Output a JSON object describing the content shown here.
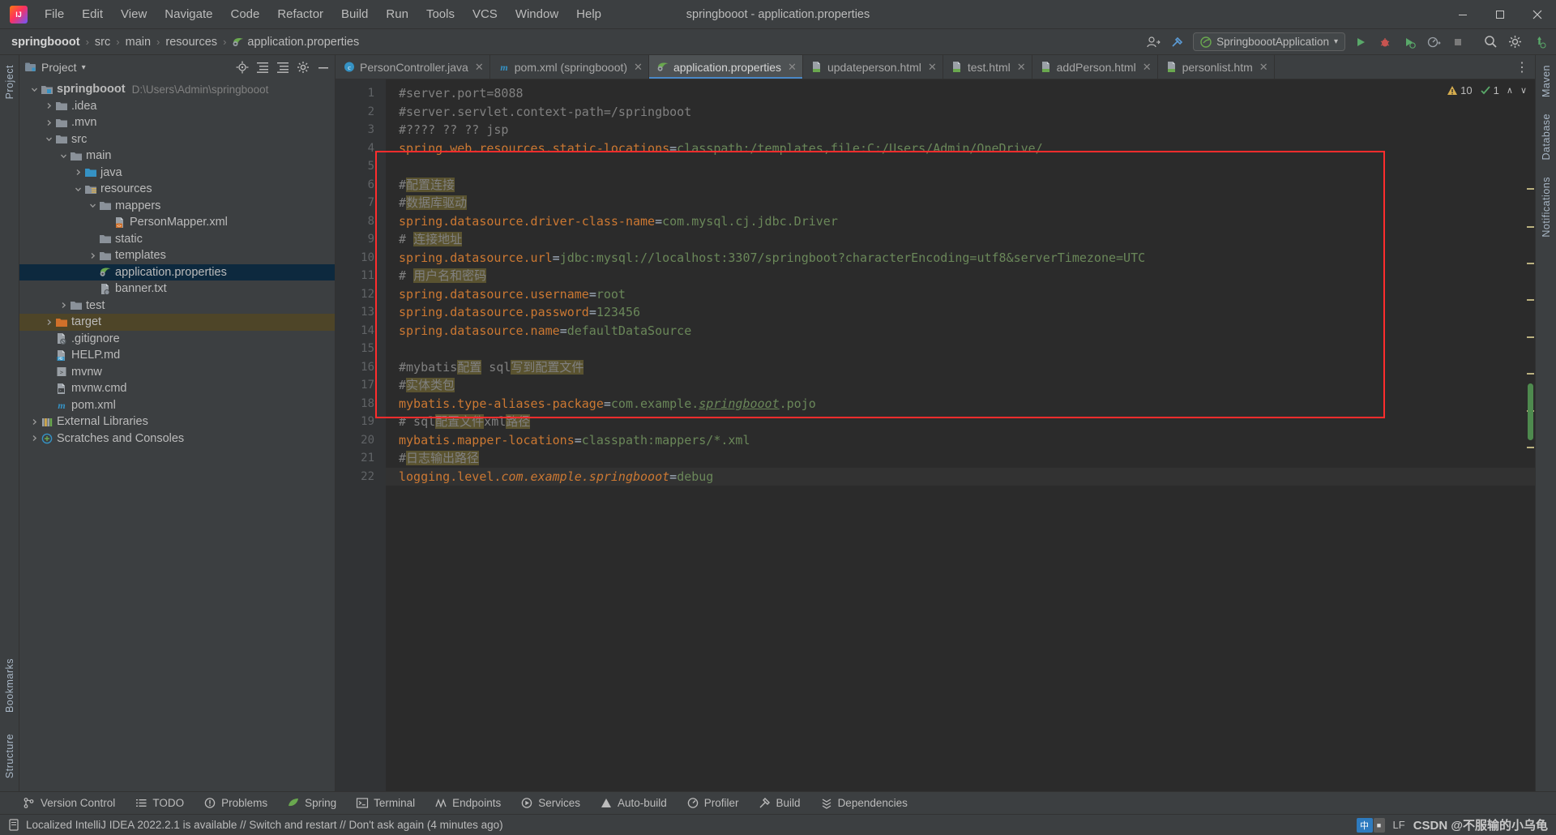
{
  "window": {
    "title": "springbooot - application.properties",
    "logo_icon": "intellij-idea-logo",
    "minimize_label": "—",
    "maximize_label": "❐",
    "close_label": "✕"
  },
  "menu": {
    "items": [
      {
        "label": "File"
      },
      {
        "label": "Edit"
      },
      {
        "label": "View"
      },
      {
        "label": "Navigate"
      },
      {
        "label": "Code"
      },
      {
        "label": "Refactor"
      },
      {
        "label": "Build"
      },
      {
        "label": "Run"
      },
      {
        "label": "Tools"
      },
      {
        "label": "VCS"
      },
      {
        "label": "Window"
      },
      {
        "label": "Help"
      }
    ]
  },
  "breadcrumb": {
    "sep": "›",
    "items": [
      {
        "label": "springbooot",
        "bold": true,
        "icon": ""
      },
      {
        "label": "src",
        "bold": false,
        "icon": ""
      },
      {
        "label": "main",
        "bold": false,
        "icon": ""
      },
      {
        "label": "resources",
        "bold": false,
        "icon": ""
      },
      {
        "label": "application.properties",
        "bold": false,
        "icon": "properties-file-icon"
      }
    ]
  },
  "navbar_right": {
    "profile_icon": "user-avatar-icon",
    "hammer_icon": "build-hammer-icon",
    "run_config": "SpringboootApplication",
    "run_config_chevron": "▾",
    "run_icon": "run-play-icon",
    "debug_icon": "debug-bug-icon",
    "coverage_icon": "run-with-coverage-icon",
    "profile_icon2": "profiler-icon",
    "stop_icon": "stop-icon",
    "search_icon": "search-everywhere-icon",
    "settings_icon": "settings-gear-icon",
    "updates_icon": "updates-icon"
  },
  "left_rail": {
    "top_label": "Project",
    "bottom_labels": [
      "Bookmarks",
      "Structure"
    ]
  },
  "right_rail": {
    "labels": [
      "Maven",
      "Database",
      "Notifications"
    ]
  },
  "project_panel": {
    "title": "Project",
    "title_chevron": "▾",
    "icons": [
      "locate-file-icon",
      "expand-all-icon",
      "collapse-all-icon",
      "settings-gear-icon",
      "hide-icon"
    ],
    "tree": [
      {
        "depth": 0,
        "twisty": "v",
        "icon": "module-folder-icon",
        "label": "springbooot",
        "bold": true,
        "path": "D:\\Users\\Admin\\springbooot",
        "state": "normal"
      },
      {
        "depth": 1,
        "twisty": ">",
        "icon": "folder-icon",
        "label": ".idea",
        "bold": false,
        "path": "",
        "state": "normal"
      },
      {
        "depth": 1,
        "twisty": ">",
        "icon": "folder-icon",
        "label": ".mvn",
        "bold": false,
        "path": "",
        "state": "normal"
      },
      {
        "depth": 1,
        "twisty": "v",
        "icon": "folder-icon",
        "label": "src",
        "bold": false,
        "path": "",
        "state": "normal"
      },
      {
        "depth": 2,
        "twisty": "v",
        "icon": "folder-icon",
        "label": "main",
        "bold": false,
        "path": "",
        "state": "normal"
      },
      {
        "depth": 3,
        "twisty": ">",
        "icon": "source-root-icon",
        "label": "java",
        "bold": false,
        "path": "",
        "state": "normal"
      },
      {
        "depth": 3,
        "twisty": "v",
        "icon": "resources-root-icon",
        "label": "resources",
        "bold": false,
        "path": "",
        "state": "normal"
      },
      {
        "depth": 4,
        "twisty": "v",
        "icon": "folder-icon",
        "label": "mappers",
        "bold": false,
        "path": "",
        "state": "normal"
      },
      {
        "depth": 5,
        "twisty": "",
        "icon": "xml-file-icon",
        "label": "PersonMapper.xml",
        "bold": false,
        "path": "",
        "state": "normal"
      },
      {
        "depth": 4,
        "twisty": "",
        "icon": "folder-icon",
        "label": "static",
        "bold": false,
        "path": "",
        "state": "normal"
      },
      {
        "depth": 4,
        "twisty": ">",
        "icon": "folder-icon",
        "label": "templates",
        "bold": false,
        "path": "",
        "state": "normal"
      },
      {
        "depth": 4,
        "twisty": "",
        "icon": "properties-file-icon",
        "label": "application.properties",
        "bold": false,
        "path": "",
        "state": "selected"
      },
      {
        "depth": 4,
        "twisty": "",
        "icon": "text-file-icon",
        "label": "banner.txt",
        "bold": false,
        "path": "",
        "state": "normal"
      },
      {
        "depth": 2,
        "twisty": ">",
        "icon": "folder-icon",
        "label": "test",
        "bold": false,
        "path": "",
        "state": "normal"
      },
      {
        "depth": 1,
        "twisty": ">",
        "icon": "target-folder-icon",
        "label": "target",
        "bold": false,
        "path": "",
        "state": "amber"
      },
      {
        "depth": 1,
        "twisty": "",
        "icon": "gitignore-file-icon",
        "label": ".gitignore",
        "bold": false,
        "path": "",
        "state": "normal"
      },
      {
        "depth": 1,
        "twisty": "",
        "icon": "markdown-file-icon",
        "label": "HELP.md",
        "bold": false,
        "path": "",
        "state": "normal"
      },
      {
        "depth": 1,
        "twisty": "",
        "icon": "script-file-icon",
        "label": "mvnw",
        "bold": false,
        "path": "",
        "state": "normal"
      },
      {
        "depth": 1,
        "twisty": "",
        "icon": "cmd-file-icon",
        "label": "mvnw.cmd",
        "bold": false,
        "path": "",
        "state": "normal"
      },
      {
        "depth": 1,
        "twisty": "",
        "icon": "maven-pom-icon",
        "label": "pom.xml",
        "bold": false,
        "path": "",
        "state": "normal"
      },
      {
        "depth": 0,
        "twisty": ">",
        "icon": "libraries-icon",
        "label": "External Libraries",
        "bold": false,
        "path": "",
        "state": "normal"
      },
      {
        "depth": 0,
        "twisty": ">",
        "icon": "scratches-icon",
        "label": "Scratches and Consoles",
        "bold": false,
        "path": "",
        "state": "normal"
      }
    ]
  },
  "editor_tabs": {
    "close_glyph": "✕",
    "more_glyph": "⋮",
    "items": [
      {
        "label": "PersonController.java",
        "icon": "java-class-icon",
        "active": false
      },
      {
        "label": "pom.xml (springbooot)",
        "icon": "maven-pom-icon",
        "active": false
      },
      {
        "label": "application.properties",
        "icon": "properties-file-icon",
        "active": true
      },
      {
        "label": "updateperson.html",
        "icon": "html-file-icon",
        "active": false
      },
      {
        "label": "test.html",
        "icon": "html-file-icon",
        "active": false
      },
      {
        "label": "addPerson.html",
        "icon": "html-file-icon",
        "active": false
      },
      {
        "label": "personlist.htm",
        "icon": "html-file-icon",
        "active": false
      }
    ]
  },
  "inspections": {
    "warning_icon": "warning-triangle-icon",
    "warning_count": "10",
    "check_icon": "inspection-check-icon",
    "check_count": "1",
    "prev_glyph": "∧",
    "next_glyph": "∨"
  },
  "code": {
    "lines": [
      {
        "n": 1,
        "segments": [
          {
            "t": "#server.port=8088",
            "c": "cm"
          }
        ]
      },
      {
        "n": 2,
        "segments": [
          {
            "t": "#server.servlet.context-path=/springboot",
            "c": "cm"
          }
        ]
      },
      {
        "n": 3,
        "segments": [
          {
            "t": "#???? ?? ?? jsp",
            "c": "cm"
          }
        ]
      },
      {
        "n": 4,
        "segments": [
          {
            "t": "spring.web.resources.static-locations",
            "c": "key"
          },
          {
            "t": "=",
            "c": "eq"
          },
          {
            "t": "classpath:/templates,file:C:/Users/Admin/OneDrive/",
            "c": "val"
          }
        ]
      },
      {
        "n": 5,
        "segments": []
      },
      {
        "n": 6,
        "segments": [
          {
            "t": "#",
            "c": "cm"
          },
          {
            "t": "配置连接",
            "c": "cm hl"
          }
        ]
      },
      {
        "n": 7,
        "segments": [
          {
            "t": "#",
            "c": "cm"
          },
          {
            "t": "数据库驱动",
            "c": "cm hl"
          }
        ]
      },
      {
        "n": 8,
        "segments": [
          {
            "t": "spring.datasource.driver-class-name",
            "c": "key"
          },
          {
            "t": "=",
            "c": "eq"
          },
          {
            "t": "com.mysql.cj.jdbc.Driver",
            "c": "val"
          }
        ]
      },
      {
        "n": 9,
        "segments": [
          {
            "t": "# ",
            "c": "cm"
          },
          {
            "t": "连接地址",
            "c": "cm hl"
          }
        ]
      },
      {
        "n": 10,
        "segments": [
          {
            "t": "spring.datasource.url",
            "c": "key"
          },
          {
            "t": "=",
            "c": "eq"
          },
          {
            "t": "jdbc:mysql://localhost:3307/springboot?characterEncoding=utf8&serverTimezone=UTC",
            "c": "val"
          }
        ]
      },
      {
        "n": 11,
        "segments": [
          {
            "t": "# ",
            "c": "cm"
          },
          {
            "t": "用户名和密码",
            "c": "cm hl"
          }
        ]
      },
      {
        "n": 12,
        "segments": [
          {
            "t": "spring.datasource.username",
            "c": "key"
          },
          {
            "t": "=",
            "c": "eq"
          },
          {
            "t": "root",
            "c": "val"
          }
        ]
      },
      {
        "n": 13,
        "segments": [
          {
            "t": "spring.datasource.password",
            "c": "key"
          },
          {
            "t": "=",
            "c": "eq"
          },
          {
            "t": "123456",
            "c": "val"
          }
        ]
      },
      {
        "n": 14,
        "segments": [
          {
            "t": "spring.datasource.name",
            "c": "key"
          },
          {
            "t": "=",
            "c": "eq"
          },
          {
            "t": "defaultDataSource",
            "c": "val"
          }
        ]
      },
      {
        "n": 15,
        "segments": []
      },
      {
        "n": 16,
        "segments": [
          {
            "t": "#mybatis",
            "c": "cm"
          },
          {
            "t": "配置",
            "c": "cm hl"
          },
          {
            "t": " sql",
            "c": "cm"
          },
          {
            "t": "写到配置文件",
            "c": "cm hl"
          }
        ]
      },
      {
        "n": 17,
        "segments": [
          {
            "t": "#",
            "c": "cm"
          },
          {
            "t": "实体类包",
            "c": "cm hl"
          }
        ]
      },
      {
        "n": 18,
        "segments": [
          {
            "t": "mybatis.type-aliases-package",
            "c": "key"
          },
          {
            "t": "=",
            "c": "eq"
          },
          {
            "t": "com.example.",
            "c": "val"
          },
          {
            "t": "springbooot",
            "c": "val ital uline"
          },
          {
            "t": ".pojo",
            "c": "val"
          }
        ]
      },
      {
        "n": 19,
        "segments": [
          {
            "t": "# sql",
            "c": "cm"
          },
          {
            "t": "配置文件",
            "c": "cm hl"
          },
          {
            "t": "xml",
            "c": "cm"
          },
          {
            "t": "路径",
            "c": "cm hl"
          }
        ]
      },
      {
        "n": 20,
        "segments": [
          {
            "t": "mybatis.mapper-locations",
            "c": "key"
          },
          {
            "t": "=",
            "c": "eq"
          },
          {
            "t": "classpath:mappers/*.xml",
            "c": "val"
          }
        ]
      },
      {
        "n": 21,
        "segments": [
          {
            "t": "#",
            "c": "cm"
          },
          {
            "t": "日志输出路径",
            "c": "cm hl"
          }
        ]
      },
      {
        "n": 22,
        "segments": [
          {
            "t": "logging.level.",
            "c": "key"
          },
          {
            "t": "com.example.springbooot",
            "c": "key ital"
          },
          {
            "t": "=",
            "c": "eq"
          },
          {
            "t": "debug",
            "c": "val"
          }
        ],
        "current": true
      }
    ]
  },
  "annotation": {
    "color": "#ff2d2d",
    "label": "red-highlight-box"
  },
  "bottom_bar": {
    "items": [
      {
        "label": "Version Control",
        "icon": "branch-icon"
      },
      {
        "label": "TODO",
        "icon": "todo-list-icon"
      },
      {
        "label": "Problems",
        "icon": "problems-icon"
      },
      {
        "label": "Spring",
        "icon": "spring-leaf-icon"
      },
      {
        "label": "Terminal",
        "icon": "terminal-icon"
      },
      {
        "label": "Endpoints",
        "icon": "endpoints-icon"
      },
      {
        "label": "Services",
        "icon": "services-icon"
      },
      {
        "label": "Auto-build",
        "icon": "auto-build-icon"
      },
      {
        "label": "Profiler",
        "icon": "profiler-icon"
      },
      {
        "label": "Build",
        "icon": "build-hammer-icon"
      },
      {
        "label": "Dependencies",
        "icon": "dependencies-icon"
      }
    ]
  },
  "status_bar": {
    "icon": "notification-icon",
    "message": "Localized IntelliJ IDEA 2022.2.1 is available // Switch and restart // Don't ask again (4 minutes ago)",
    "ime_primary": "中",
    "ime_secondary": "■",
    "line_sep": "LF",
    "watermark": "CSDN @不服输的小乌龟"
  },
  "colors": {
    "accent": "#4a88c7",
    "selection": "#0d293e",
    "amber": "#4e4528",
    "comment": "#808080",
    "key": "#cc7832",
    "value": "#6a8759",
    "highlight": "#5a5330",
    "red": "#ff2d2d"
  }
}
